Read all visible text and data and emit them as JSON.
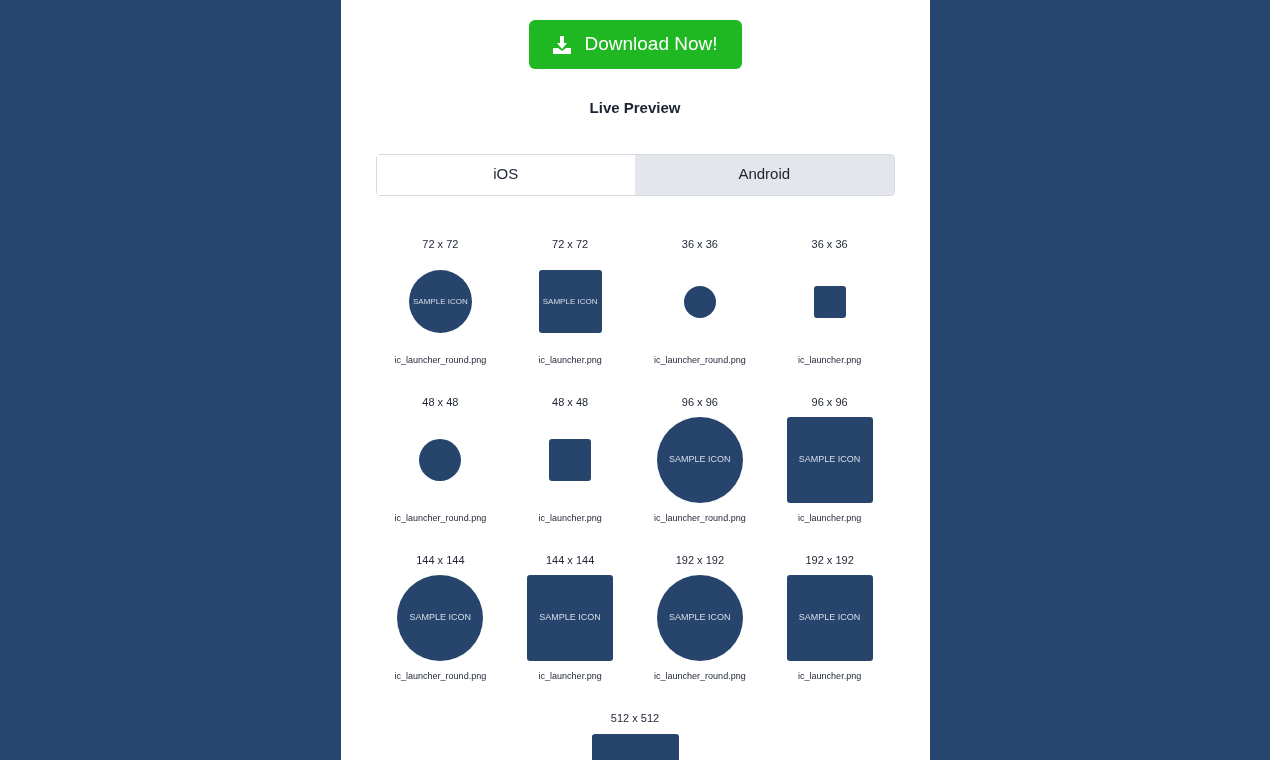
{
  "download_button": {
    "label": "Download Now!"
  },
  "heading": "Live Preview",
  "tabs": [
    {
      "label": "iOS",
      "selected": false
    },
    {
      "label": "Android",
      "selected": true
    }
  ],
  "icons": [
    {
      "size_label": "72 x 72",
      "kind": "round-large",
      "icon_text": "SAMPLE ICON",
      "filename": "ic_launcher_round.png"
    },
    {
      "size_label": "72 x 72",
      "kind": "square-large",
      "icon_text": "SAMPLE ICON",
      "filename": "ic_launcher.png"
    },
    {
      "size_label": "36 x 36",
      "kind": "round-small",
      "filename": "ic_launcher_round.png"
    },
    {
      "size_label": "36 x 36",
      "kind": "square-small",
      "filename": "ic_launcher.png"
    },
    {
      "size_label": "48 x 48",
      "kind": "round-medium",
      "filename": "ic_launcher_round.png"
    },
    {
      "size_label": "48 x 48",
      "kind": "square-medium",
      "filename": "ic_launcher.png"
    },
    {
      "size_label": "96 x 96",
      "kind": "round-xlarge",
      "icon_text": "SAMPLE ICON",
      "filename": "ic_launcher_round.png"
    },
    {
      "size_label": "96 x 96",
      "kind": "square-xlarge",
      "icon_text": "SAMPLE ICON",
      "filename": "ic_launcher.png"
    },
    {
      "size_label": "144 x 144",
      "kind": "round-xlarge",
      "icon_text": "SAMPLE ICON",
      "filename": "ic_launcher_round.png"
    },
    {
      "size_label": "144 x 144",
      "kind": "square-xlarge",
      "icon_text": "SAMPLE ICON",
      "filename": "ic_launcher.png"
    },
    {
      "size_label": "192 x 192",
      "kind": "round-xlarge",
      "icon_text": "SAMPLE ICON",
      "filename": "ic_launcher_round.png"
    },
    {
      "size_label": "192 x 192",
      "kind": "square-xlarge",
      "icon_text": "SAMPLE ICON",
      "filename": "ic_launcher.png"
    }
  ],
  "large_icon": {
    "size_label": "512 x 512",
    "kind": "square"
  }
}
